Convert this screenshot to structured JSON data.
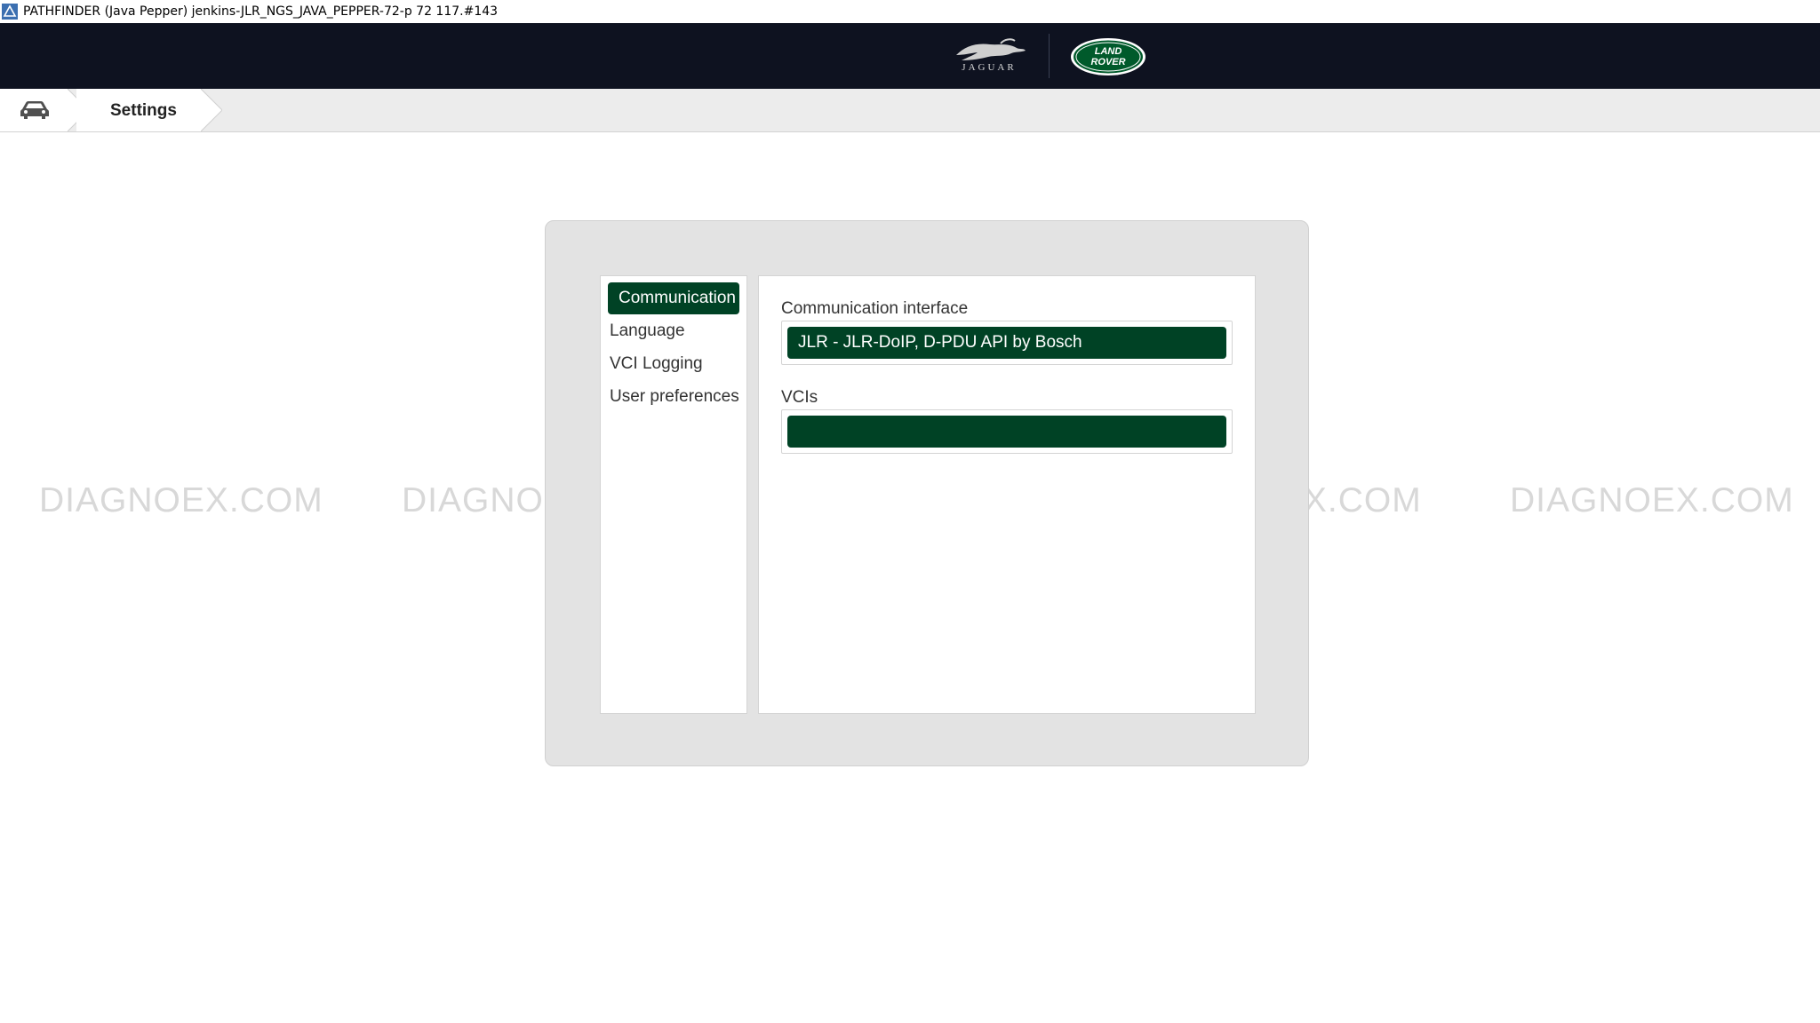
{
  "window": {
    "title": "PATHFINDER (Java Pepper) jenkins-JLR_NGS_JAVA_PEPPER-72-p 72 117.#143"
  },
  "header": {
    "brands": [
      "JAGUAR",
      "LAND ROVER"
    ],
    "jaguar_wordmark": "JAGUAR",
    "landrover_line1": "LAND",
    "landrover_line2": "ROVER",
    "background_color": "#0e1220"
  },
  "breadcrumb": {
    "home_icon": "car-icon",
    "current": "Settings"
  },
  "settings": {
    "menu": [
      {
        "label": "Communication",
        "active": true
      },
      {
        "label": "Language",
        "active": false
      },
      {
        "label": "VCI Logging",
        "active": false
      },
      {
        "label": "User preferences",
        "active": false
      }
    ],
    "communication_interface": {
      "label": "Communication interface",
      "value": "JLR - JLR-DoIP, D-PDU API by Bosch"
    },
    "vcis": {
      "label": "VCIs",
      "value": ""
    }
  },
  "watermark": {
    "text": "DIAGNOEX.COM",
    "repeats": 5
  },
  "colors": {
    "accent_green": "#004225",
    "dialog_background": "#e3e3e3",
    "breadcrumb_background": "#ececec"
  }
}
